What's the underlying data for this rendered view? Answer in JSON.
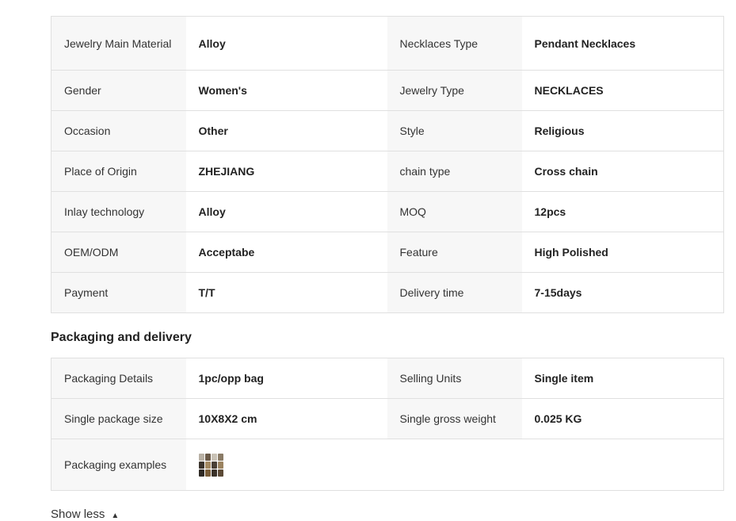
{
  "attributes": [
    [
      "Jewelry Main Material",
      "Alloy",
      "Necklaces Type",
      "Pendant Necklaces"
    ],
    [
      "Gender",
      "Women's",
      "Jewelry Type",
      "NECKLACES"
    ],
    [
      "Occasion",
      "Other",
      "Style",
      "Religious"
    ],
    [
      "Place of Origin",
      "ZHEJIANG",
      "chain type",
      "Cross chain"
    ],
    [
      "Inlay technology",
      "Alloy",
      "MOQ",
      "12pcs"
    ],
    [
      "OEM/ODM",
      "Acceptabe",
      "Feature",
      "High Polished"
    ],
    [
      "Payment",
      "T/T",
      "Delivery time",
      "7-15days"
    ]
  ],
  "packaging": {
    "heading": "Packaging and delivery",
    "rows": [
      [
        "Packaging Details",
        "1pc/opp bag",
        "Selling Units",
        "Single item"
      ],
      [
        "Single package size",
        "10X8X2 cm",
        "Single gross weight",
        "0.025 KG"
      ]
    ],
    "examples_label": "Packaging examples",
    "examples_icon": "packaging-thumbnail-image"
  },
  "show_less_label": "Show less",
  "show_less_icon": "chevron-up-icon"
}
